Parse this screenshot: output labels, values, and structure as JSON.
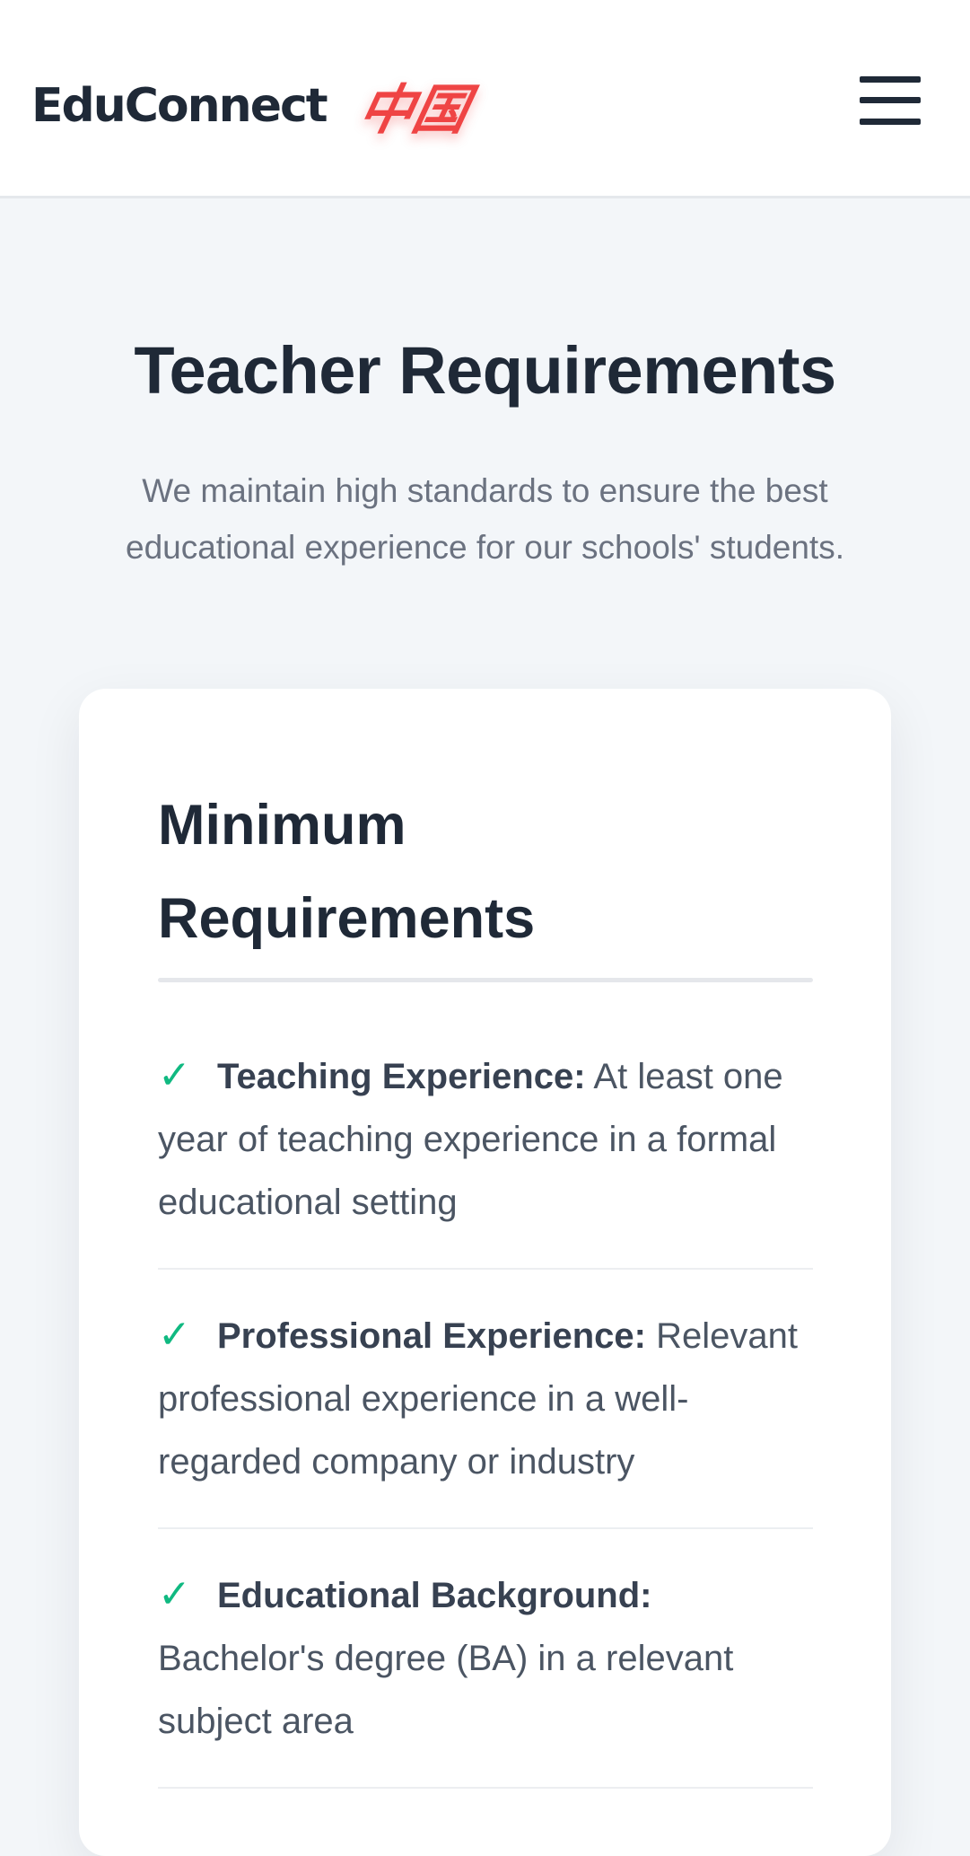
{
  "header": {
    "brand_name": "EduConnect",
    "brand_mark": "中国",
    "menu_icon": "hamburger-menu-icon"
  },
  "hero": {
    "title": "Teacher Requirements",
    "subtitle": "We maintain high standards to ensure the best educational experience for our schools' students."
  },
  "requirements": {
    "title": "Minimum Requirements",
    "check_icon": "✓",
    "items": [
      {
        "label": "Teaching Experience:",
        "text": "At least one year of teaching experience in a formal educational setting"
      },
      {
        "label": "Professional Experience:",
        "text": "Relevant professional experience in a well-regarded company or industry"
      },
      {
        "label": "Educational Background:",
        "text": "Bachelor's degree (BA) in a relevant subject area"
      }
    ]
  },
  "colors": {
    "accent_red": "#ef4444",
    "check_green": "#10b981",
    "text_dark": "#1f2937",
    "text_muted": "#6b7280",
    "page_bg": "#f3f6f9"
  }
}
